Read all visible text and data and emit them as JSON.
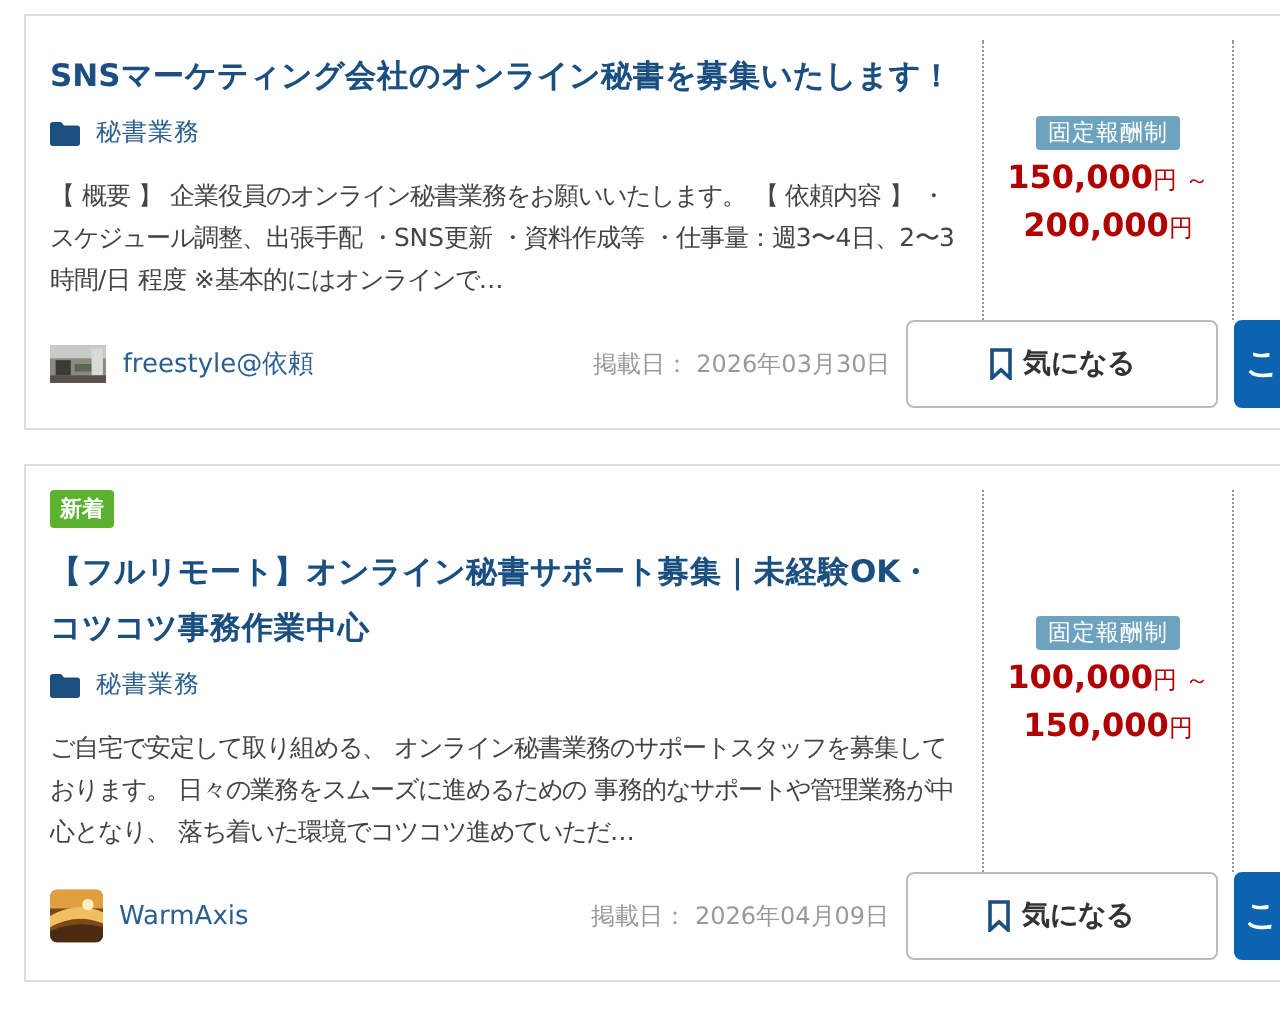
{
  "jobs": [
    {
      "title": "SNSマーケティング会社のオンライン秘書を募集いたします！",
      "category": "秘書業務",
      "description": "【 概要 】 企業役員のオンライン秘書業務をお願いいたします。 【 依頼内容 】 ・スケジュール調整、出張手配 ・SNS更新 ・資料作成等 ・仕事量：週3〜4日、2〜3時間/日 程度 ※基本的にはオンラインで…",
      "pay_type": "固定報酬制",
      "price_min": "150,000",
      "price_max": "200,000",
      "unit_min": "円",
      "unit_max": "円",
      "range_sep": "～",
      "client": "freestyle@依頼",
      "posted_label": "掲載日：",
      "posted_date": "2026年03月30日",
      "bookmark_label": "気になる",
      "primary_label": "こ"
    },
    {
      "badge": "新着",
      "title": "【フルリモート】オンライン秘書サポート募集｜未経験OK・コツコツ事務作業中心",
      "category": "秘書業務",
      "description": "ご自宅で安定して取り組める、 オンライン秘書業務のサポートスタッフを募集しております。 日々の業務をスムーズに進めるための 事務的なサポートや管理業務が中心となり、 落ち着いた環境でコツコツ進めていただ…",
      "pay_type": "固定報酬制",
      "price_min": "100,000",
      "price_max": "150,000",
      "unit_min": "円",
      "unit_max": "円",
      "range_sep": "～",
      "client": "WarmAxis",
      "posted_label": "掲載日：",
      "posted_date": "2026年04月09日",
      "bookmark_label": "気になる",
      "primary_label": "こ"
    }
  ]
}
